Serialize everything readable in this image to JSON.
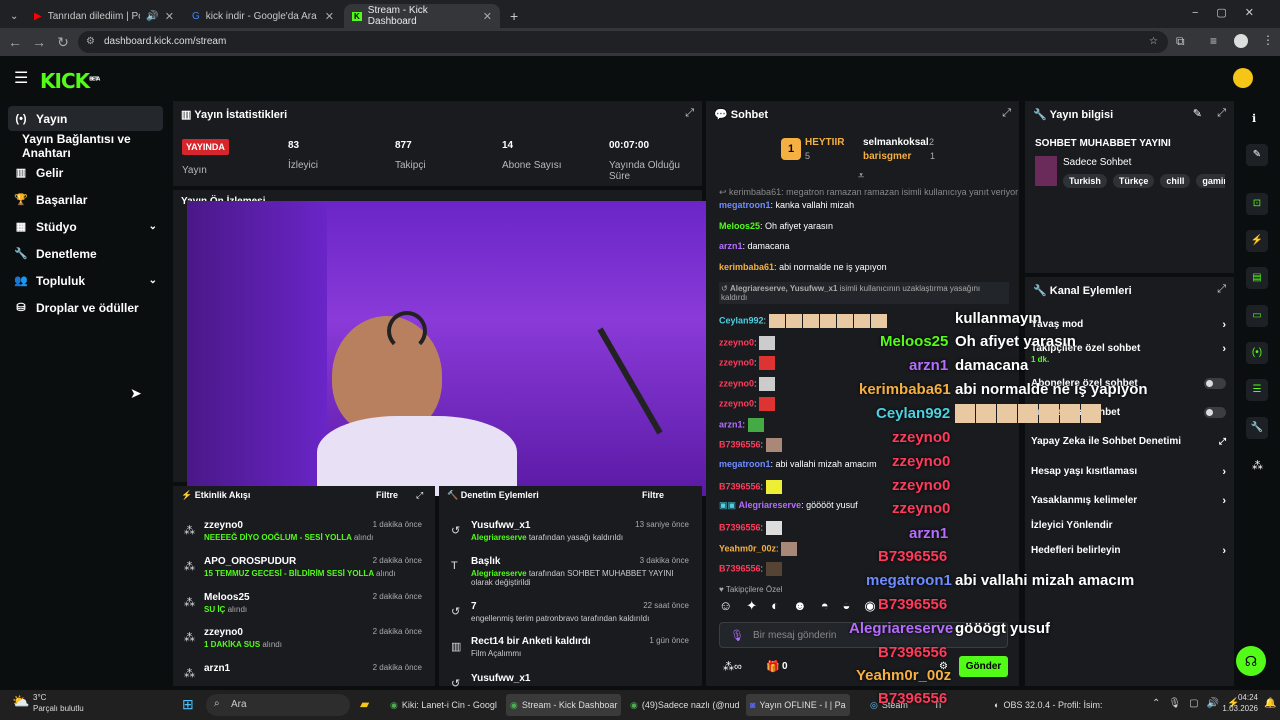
{
  "browser": {
    "tabs": [
      {
        "title": "Tanrıdan dilediim | Polat Ale",
        "active": false
      },
      {
        "title": "kick indir - Google'da Ara",
        "active": false
      },
      {
        "title": "Stream - Kick Dashboard",
        "active": true
      }
    ],
    "url": "dashboard.kick.com/stream"
  },
  "app": {
    "logo": "KICK",
    "beta": "BETA"
  },
  "sidebar": {
    "items": [
      {
        "label": "Yayın",
        "active": true
      },
      {
        "label": "Yayın Bağlantısı ve Anahtarı"
      },
      {
        "label": "Gelir"
      },
      {
        "label": "Başarılar"
      },
      {
        "label": "Stüdyo"
      },
      {
        "label": "Denetleme"
      },
      {
        "label": "Topluluk"
      },
      {
        "label": "Droplar ve ödüller"
      }
    ]
  },
  "stats": {
    "title": "Yayın İstatistikleri",
    "live_badge": "YAYINDA",
    "live_label": "Yayın",
    "items": [
      {
        "value": "83",
        "label": "İzleyici"
      },
      {
        "value": "877",
        "label": "Takipçi"
      },
      {
        "value": "14",
        "label": "Abone Sayısı"
      },
      {
        "value": "00:07:00",
        "label": "Yayında Olduğu Süre"
      }
    ],
    "preview_title": "Yayın Ön İzlemesi"
  },
  "activity": {
    "title": "Etkinlik Akışı",
    "filter": "Filtre",
    "items": [
      {
        "name": "zzeyno0",
        "text": "NEEEEĞ DİYO OOĞLUM - SESİ YOLLA",
        "suffix": "alındı",
        "time": "1 dakika önce"
      },
      {
        "name": "APO_OROSPUDUR",
        "text": "15 TEMMUZ GECESİ - BİLDİRİM SESİ YOLLA",
        "suffix": "alındı",
        "time": "2 dakika önce"
      },
      {
        "name": "Meloos25",
        "text": "SU İÇ",
        "suffix": "alındı",
        "time": "2 dakika önce"
      },
      {
        "name": "zzeyno0",
        "text": "1 DAKİKA SUS",
        "suffix": "alındı",
        "time": "2 dakika önce"
      },
      {
        "name": "arzn1",
        "text": "",
        "suffix": "",
        "time": "2 dakika önce"
      }
    ]
  },
  "moderation": {
    "title": "Denetim Eylemleri",
    "filter": "Filtre",
    "items": [
      {
        "name": "Yusufww_x1",
        "l1a": "Alegriareserve",
        "l1b": " tarafından yasağı kaldırıldı",
        "l2": "",
        "time": "13 saniye önce"
      },
      {
        "name": "Başlık",
        "l1a": "Alegriareserve",
        "l1b": " tarafından SOHBET MUHABBET YAYINI",
        "l2": "olarak değiştirildi",
        "time": "3 dakika önce"
      },
      {
        "name": "7",
        "l1a": "",
        "l1b": "engellenmiş terim patronbravo tarafından kaldırıldı",
        "l2": "",
        "time": "22 saat önce"
      },
      {
        "name": "Rect14 bir Anketi kaldırdı",
        "l1a": "",
        "l1b": "Film Açalımmı",
        "l2": "",
        "time": "1 gün önce"
      },
      {
        "name": "Yusufww_x1",
        "l1a": "",
        "l1b": "",
        "l2": "",
        "time": ""
      }
    ]
  },
  "chat": {
    "title": "Sohbet",
    "leaders": [
      {
        "rank": "1",
        "name": "HEYTIIR",
        "count": "5"
      },
      {
        "name": "selmankoksal",
        "count": "2"
      },
      {
        "name": "barisgmer",
        "count": "1"
      }
    ],
    "messages": [
      {
        "user": "kerimbaba61",
        "text": "megatron ramazan ramazan isimli kullanıcıya yanıt veriyor",
        "color": "#888888"
      },
      {
        "user": "megatroon1",
        "text": "kanka vallahi mizah",
        "color": "#6f8cff"
      },
      {
        "user": "Meloos25",
        "text": "Oh afiyet yarasın",
        "color": "#53fc18"
      },
      {
        "user": "arzn1",
        "text": "damacana",
        "color": "#b56cff"
      },
      {
        "user": "kerimbaba61",
        "text": "abi normalde ne iş yapıyon",
        "color": "#f5b041"
      },
      {
        "user": "Alegriareserve, Yusufww_x1",
        "text": "isimli kullanıcının uzaklaştırma yasağını kaldırdı",
        "color": "#aaaaaa"
      },
      {
        "user": "Ceylan992",
        "text": "",
        "color": "#4dd0e1"
      },
      {
        "user": "zzeyno0",
        "text": "",
        "color": "#ff3b5c"
      },
      {
        "user": "zzeyno0",
        "text": "",
        "color": "#ff3b5c"
      },
      {
        "user": "zzeyno0",
        "text": "",
        "color": "#ff3b5c"
      },
      {
        "user": "zzeyno0",
        "text": "",
        "color": "#ff3b5c"
      },
      {
        "user": "arzn1",
        "text": "",
        "color": "#b56cff"
      },
      {
        "user": "B7396556",
        "text": "",
        "color": "#ff3b5c"
      },
      {
        "user": "megatroon1",
        "text": "abi vallahi mizah amacım",
        "color": "#6f8cff"
      },
      {
        "user": "B7396556",
        "text": "",
        "color": "#ff3b5c"
      },
      {
        "user": "Alegriareserve",
        "text": "gööööt yusuf",
        "color": "#b56cff"
      },
      {
        "user": "B7396556",
        "text": "",
        "color": "#ff3b5c"
      },
      {
        "user": "Yeahm0r_00z",
        "text": "",
        "color": "#f5b041"
      },
      {
        "user": "B7396556",
        "text": "",
        "color": "#ff3b5c"
      }
    ],
    "followers_only": "Takipçilere Özel",
    "input_placeholder": "Bir mesaj gönderin",
    "points": "0",
    "send": "Gönder"
  },
  "overlay": {
    "lines": [
      {
        "user": "",
        "text": "kullanmayın"
      },
      {
        "user": "Meloos25",
        "text": "Oh afiyet yarasın"
      },
      {
        "user": "arzn1",
        "text": "damacana"
      },
      {
        "user": "kerimbaba61",
        "text": "abi normalde ne iş yapıyon"
      },
      {
        "user": "Ceylan992",
        "text": ""
      },
      {
        "user": "zzeyno0",
        "text": ""
      },
      {
        "user": "zzeyno0",
        "text": ""
      },
      {
        "user": "zzeyno0",
        "text": ""
      },
      {
        "user": "zzeyno0",
        "text": ""
      },
      {
        "user": "arzn1",
        "text": ""
      },
      {
        "user": "B7396556",
        "text": ""
      },
      {
        "user": "megatroon1",
        "text": "abi vallahi mizah amacım"
      },
      {
        "user": "B7396556",
        "text": ""
      },
      {
        "user": "Alegriareserve",
        "text": "gööögt yusuf"
      },
      {
        "user": "B7396556",
        "text": ""
      },
      {
        "user": "Yeahm0r_00z",
        "text": ""
      },
      {
        "user": "B7396556",
        "text": ""
      }
    ]
  },
  "stream_info": {
    "title": "Yayın bilgisi",
    "stream_title": "SOHBET MUHABBET YAYINI",
    "category": "Sadece Sohbet",
    "tags": [
      "Turkish",
      "Türkçe",
      "chill",
      "gamin"
    ]
  },
  "channel": {
    "title": "Kanal Eylemleri",
    "rows": [
      {
        "label": "Yavaş mod",
        "sub": "",
        "control": "chevron"
      },
      {
        "label": "Takipçilere özel sohbet",
        "sub": "1 dk.",
        "control": "chevron"
      },
      {
        "label": "Abonelere özel sohbet",
        "sub": "",
        "control": "toggle"
      },
      {
        "label": "Emote'larla sohbet",
        "sub": "",
        "control": "toggle"
      },
      {
        "label": "Yapay Zeka ile Sohbet Denetimi",
        "sub": "",
        "control": "external"
      },
      {
        "label": "Hesap yaşı kısıtlaması",
        "sub": "",
        "control": "chevron"
      },
      {
        "label": "Yasaklanmış kelimeler",
        "sub": "",
        "control": "chevron"
      },
      {
        "label": "İzleyici Yönlendir",
        "sub": "",
        "control": "none"
      },
      {
        "label": "Hedefleri belirleyin",
        "sub": "",
        "control": "chevron"
      }
    ]
  },
  "taskbar": {
    "weather_temp": "3°C",
    "weather_desc": "Parçalı bulutlu",
    "search": "Ara",
    "apps": [
      {
        "label": "Kiki: Lanet-i Cin - Googl"
      },
      {
        "label": "Stream - Kick Dashboar"
      },
      {
        "label": "(49)Sadece nazlı (@nud"
      },
      {
        "label": "Yayın OFLINE - I | Pa"
      },
      {
        "label": "Steam"
      },
      {
        "label": "Ti"
      },
      {
        "label": "OBS 32.0.4 - Profil: İsim:"
      }
    ],
    "time": "04:24",
    "date": "1.03.2026"
  },
  "colors": {
    "accent": "#53fc18",
    "live": "#d6262b",
    "panel": "#191b1f",
    "bg": "#0b0e0f"
  }
}
